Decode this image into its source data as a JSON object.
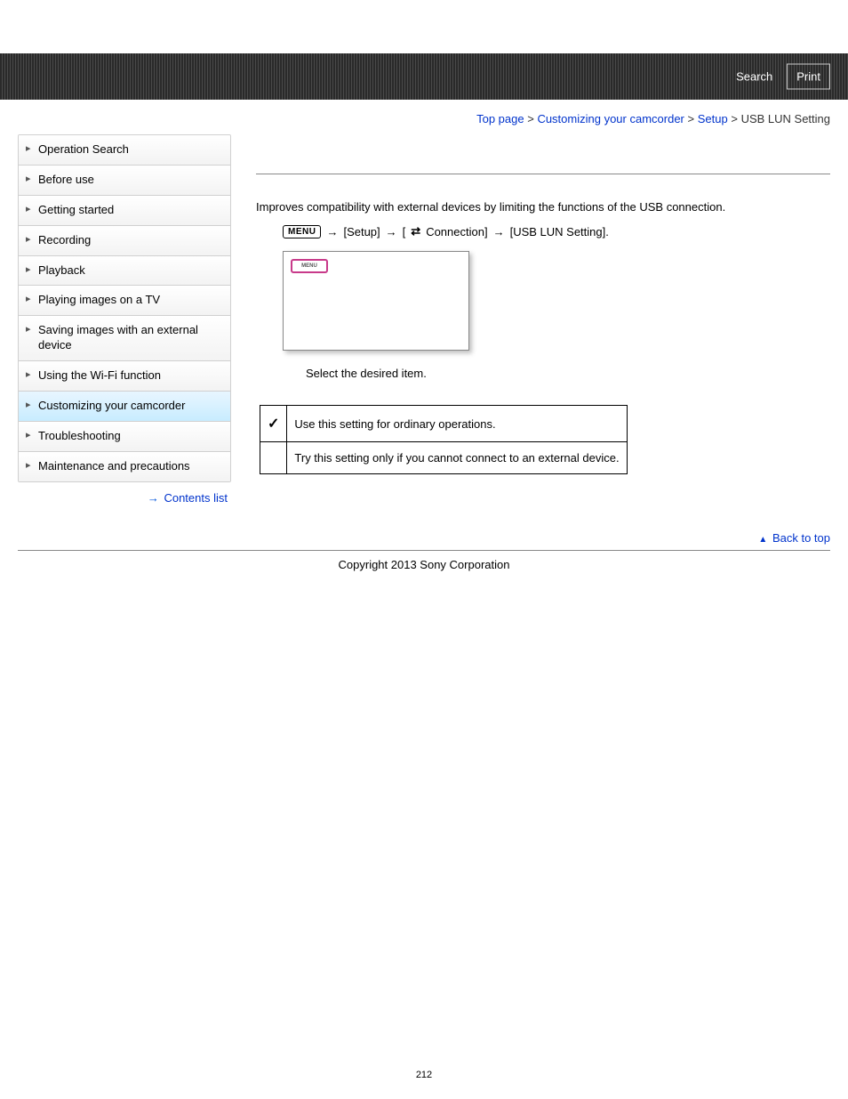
{
  "header": {
    "search": "Search",
    "print": "Print"
  },
  "breadcrumb": {
    "top": "Top page",
    "customizing": "Customizing your camcorder",
    "setup": "Setup",
    "current": "USB LUN Setting"
  },
  "sidebar": {
    "items": [
      {
        "label": "Operation Search",
        "active": false
      },
      {
        "label": "Before use",
        "active": false
      },
      {
        "label": "Getting started",
        "active": false
      },
      {
        "label": "Recording",
        "active": false
      },
      {
        "label": "Playback",
        "active": false
      },
      {
        "label": "Playing images on a TV",
        "active": false
      },
      {
        "label": "Saving images with an external device",
        "active": false
      },
      {
        "label": "Using the Wi-Fi function",
        "active": false
      },
      {
        "label": "Customizing your camcorder",
        "active": true
      },
      {
        "label": "Troubleshooting",
        "active": false
      },
      {
        "label": "Maintenance and precautions",
        "active": false
      }
    ],
    "contents_link": "Contents list"
  },
  "main": {
    "description": "Improves compatibility with external devices by limiting the functions of the USB connection.",
    "menu_badge": "MENU",
    "path_setup": "[Setup]",
    "path_conn_prefix": "[",
    "path_conn": "Connection]",
    "path_target": "[USB LUN Setting].",
    "screen_menu": "MENU",
    "select_text": "Select the desired item.",
    "table": {
      "row1": "Use this setting for ordinary operations.",
      "row2": "Try this setting only if you cannot connect to an external device."
    }
  },
  "footer": {
    "back_to_top": "Back to top",
    "copyright": "Copyright 2013 Sony Corporation",
    "page_number": "212"
  }
}
